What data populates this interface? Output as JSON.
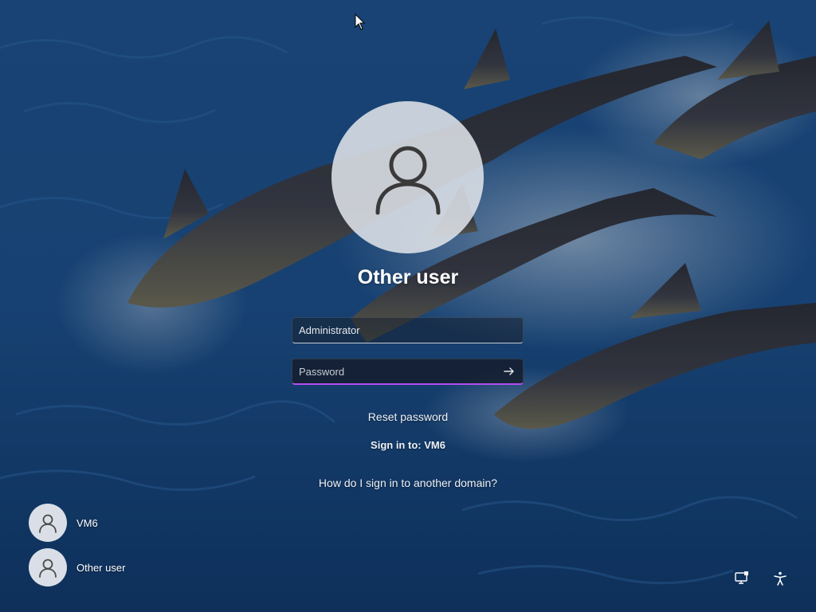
{
  "signin": {
    "title": "Other user",
    "username_value": "Administrator",
    "password_placeholder": "Password",
    "reset_password": "Reset password",
    "sign_in_to": "Sign in to: VM6",
    "other_domain_help": "How do I sign in to another domain?"
  },
  "user_tiles": [
    {
      "label": "VM6",
      "icon": "user-icon"
    },
    {
      "label": "Other user",
      "icon": "user-icon"
    }
  ],
  "corner_icons": [
    "network-icon",
    "accessibility-icon"
  ],
  "colors": {
    "focus_accent": "#b24df0",
    "avatar_bg": "#dee2e8",
    "text": "#ffffff"
  }
}
